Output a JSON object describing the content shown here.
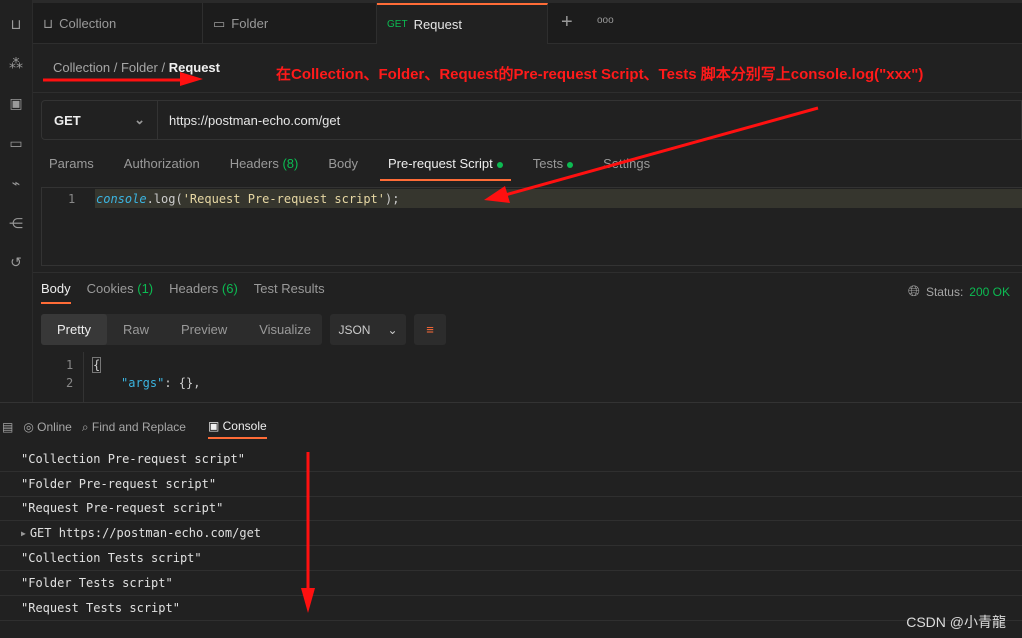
{
  "tabs": [
    {
      "label": "Collection",
      "icon": "collection-icon"
    },
    {
      "label": "Folder",
      "icon": "folder-icon"
    },
    {
      "method": "GET",
      "label": "Request",
      "active": true
    }
  ],
  "breadcrumb": {
    "items": [
      "Collection",
      "Folder"
    ],
    "current": "Request",
    "sep": "/"
  },
  "annotation": "在Collection、Folder、Request的Pre-request Script、Tests 脚本分别写上console.log(\"xxx\")",
  "request": {
    "method": "GET",
    "url": "https://postman-echo.com/get"
  },
  "request_tabs": [
    {
      "label": "Params"
    },
    {
      "label": "Authorization"
    },
    {
      "label": "Headers",
      "count": "(8)"
    },
    {
      "label": "Body"
    },
    {
      "label": "Pre-request Script",
      "dot": true,
      "active": true
    },
    {
      "label": "Tests",
      "dot": true
    },
    {
      "label": "Settings"
    }
  ],
  "editor": {
    "line": "1",
    "obj": "console",
    "rest": ".log(",
    "str": "'Request Pre-request script'",
    "end": ");"
  },
  "response_tabs": [
    {
      "label": "Body",
      "active": true
    },
    {
      "label": "Cookies",
      "count": "(1)"
    },
    {
      "label": "Headers",
      "count": "(6)"
    },
    {
      "label": "Test Results"
    }
  ],
  "status": {
    "label": "Status:",
    "value": "200 OK"
  },
  "view_modes": [
    "Pretty",
    "Raw",
    "Preview",
    "Visualize"
  ],
  "format": "JSON",
  "body_lines": [
    {
      "n": "1",
      "text": "{"
    },
    {
      "n": "2",
      "key": "\"args\"",
      "rest": ": {},"
    }
  ],
  "console_toolbar": {
    "online": "Online",
    "find": "Find and Replace",
    "console": "Console"
  },
  "console_logs": [
    "\"Collection Pre-request script\"",
    "\"Folder Pre-request script\"",
    "\"Request Pre-request script\"",
    "GET https://postman-echo.com/get",
    "\"Collection Tests script\"",
    "\"Folder Tests script\"",
    "\"Request Tests script\""
  ],
  "watermark": "CSDN @小青龍",
  "colors": {
    "accent": "#ff6c37",
    "green": "#0cbb52",
    "annotation": "#ff1a1a"
  }
}
